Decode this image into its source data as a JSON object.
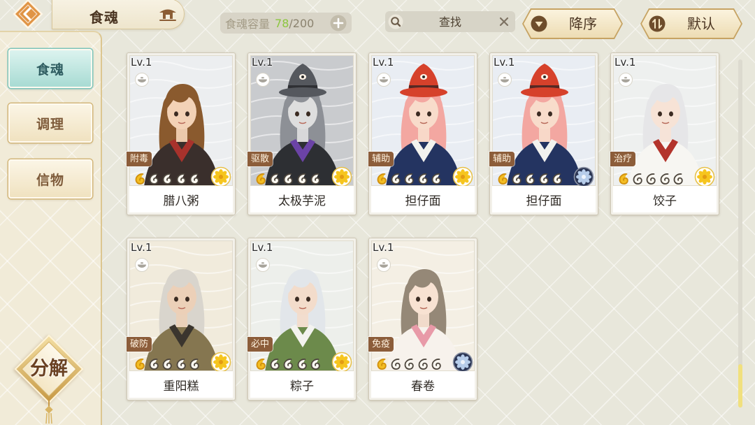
{
  "header": {
    "title": "食魂",
    "back_icon": "back-arrow-icon",
    "home_icon": "pavilion-icon",
    "capacity": {
      "label": "食魂容量",
      "current": "78",
      "max": "/200",
      "current_color": "#8cc63f",
      "add_icon": "plus-icon"
    },
    "search": {
      "placeholder": "查找",
      "icon": "search-icon",
      "clear_icon": "close-icon"
    },
    "sort_order": {
      "label": "降序",
      "icon": "triangle-down-icon"
    },
    "sort_mode": {
      "label": "默认",
      "icon": "sort-arrows-icon"
    }
  },
  "sidebar": {
    "tabs": [
      {
        "label": "食魂",
        "active": true
      },
      {
        "label": "调理",
        "active": false
      },
      {
        "label": "信物",
        "active": false
      }
    ],
    "decompose_label": "分解"
  },
  "colors": {
    "star_filled": "#f3bd23",
    "star_empty": "#4d463d",
    "tag_bg": "#8c5d3a"
  },
  "cards": [
    {
      "level": "Lv.1",
      "tag": "附毒",
      "name": "腊八粥",
      "stars_filled": 1,
      "stars_total": 5,
      "emblem": "gold-flower-icon",
      "portrait": {
        "bg": "#eceef0",
        "skin": "#f3d2b6",
        "hair": "#8a5a2e",
        "outfit": "#3a2f2c",
        "accent": "#a8322c"
      }
    },
    {
      "level": "Lv.1",
      "tag": "驱散",
      "name": "太极芋泥",
      "stars_filled": 1,
      "stars_total": 5,
      "emblem": "gold-flower-icon",
      "portrait": {
        "bg": "#c9cbce",
        "skin": "#dedede",
        "hair": "#8d9096",
        "outfit": "#2d2f33",
        "accent": "#6b43a6",
        "hat": "#55585e"
      }
    },
    {
      "level": "Lv.1",
      "tag": "辅助",
      "name": "担仔面",
      "stars_filled": 1,
      "stars_total": 5,
      "emblem": "gold-flower-icon",
      "portrait": {
        "bg": "#e9edf3",
        "skin": "#f8dccb",
        "hair": "#f3a7a1",
        "outfit": "#243461",
        "accent": "#f2f2ee",
        "hat": "#d6412b"
      }
    },
    {
      "level": "Lv.1",
      "tag": "辅助",
      "name": "担仔面",
      "stars_filled": 1,
      "stars_total": 5,
      "emblem": "navy-flower-icon",
      "portrait": {
        "bg": "#e9edf3",
        "skin": "#f8dccb",
        "hair": "#f3a7a1",
        "outfit": "#243461",
        "accent": "#f2f2ee",
        "hat": "#d6412b"
      }
    },
    {
      "level": "Lv.1",
      "tag": "治疗",
      "name": "饺子",
      "stars_filled": 1,
      "stars_total": 5,
      "emblem": "gold-flower-icon",
      "portrait": {
        "bg": "#eef0ef",
        "skin": "#f7e3d6",
        "hair": "#e6e6e8",
        "outfit": "#f7f6f2",
        "accent": "#b3342c"
      }
    },
    {
      "level": "Lv.1",
      "tag": "破防",
      "name": "重阳糕",
      "stars_filled": 1,
      "stars_total": 5,
      "emblem": "gold-flower-icon",
      "portrait": {
        "bg": "#f1ebdc",
        "skin": "#ecd0b8",
        "hair": "#d9d5cd",
        "outfit": "#857650",
        "accent": "#3a352e"
      }
    },
    {
      "level": "Lv.1",
      "tag": "必中",
      "name": "粽子",
      "stars_filled": 1,
      "stars_total": 5,
      "emblem": "gold-flower-icon",
      "portrait": {
        "bg": "#edefeb",
        "skin": "#f3dccb",
        "hair": "#e2e6ea",
        "outfit": "#6c8a4b",
        "accent": "#f3f3ef"
      }
    },
    {
      "level": "Lv.1",
      "tag": "免疫",
      "name": "春卷",
      "stars_filled": 1,
      "stars_total": 5,
      "emblem": "navy-flower-icon",
      "portrait": {
        "bg": "#f4efe4",
        "skin": "#f8e2d2",
        "hair": "#958877",
        "outfit": "#f7f2ec",
        "accent": "#e89aa8"
      }
    }
  ],
  "scrollbar": {
    "position": 1
  }
}
